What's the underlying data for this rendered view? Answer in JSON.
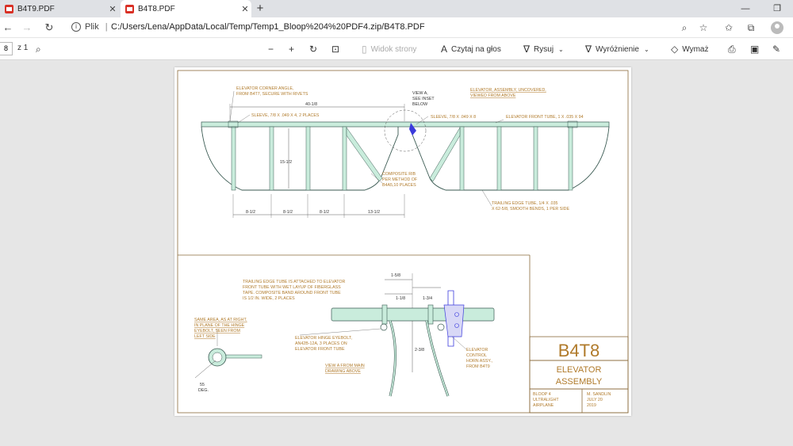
{
  "browser": {
    "tabs": [
      {
        "label": "B4T9.PDF",
        "active": false
      },
      {
        "label": "B4T8.PDF",
        "active": true
      }
    ],
    "site_label": "Plik",
    "url": "C:/Users/Lena/AppData/Local/Temp/Temp1_Bloop%204%20PDF4.zip/B4T8.PDF"
  },
  "pdf_toolbar": {
    "page_current": "8",
    "page_total": "z 1",
    "page_view": "Widok strony",
    "read_aloud": "Czytaj na głos",
    "draw": "Rysuj",
    "highlight": "Wyróżnienie",
    "erase": "Wymaż"
  },
  "drawing": {
    "title_block": {
      "number": "B4T8",
      "title_line1": "ELEVATOR",
      "title_line2": "ASSEMBLY",
      "project_line1": "BLOOP 4",
      "project_line2": "ULTRALIGHT",
      "project_line3": "AIRPLANE",
      "author": "M. SANDLIN",
      "date_line1": "JULY 20",
      "date_line2": "2019"
    },
    "notes": {
      "corner_angle_1": "ELEVATOR CORNER ANGLE,",
      "corner_angle_2": "FROM B4T7, SECURE WITH RIVETS",
      "dim_40": "40-1/8",
      "sleeve_left": "SLEEVE, 7/8 X .049 X 4, 2 PLACES",
      "view_a_1": "VIEW A,",
      "view_a_2": "SEE INSET",
      "view_a_3": "BELOW",
      "sleeve_center": "SLEEVE, 7/8 X .049 X 8",
      "assy_title_1": "ELEVATOR, ASSEMBLY, UNCOVERED,",
      "assy_title_2": "VIEWED FROM ABOVE",
      "front_tube": "ELEVATOR FRONT TUBE, 1 X .035 X 94",
      "dim_15": "15-1/2",
      "composite_rib_1": "COMPOSITE RIB",
      "composite_rib_2": "PER METHOD OF",
      "composite_rib_3": "B4A5,10 PLACES",
      "trailing_edge_1": "TRAILING EDGE TUBE, 1/4 X .035",
      "trailing_edge_2": "X 62-5/8, SMOOTH BENDS, 1 PER SIDE",
      "dim_8a": "8-1/2",
      "dim_8b": "8-1/2",
      "dim_8c": "8-1/2",
      "dim_13": "13-1/2",
      "te_attach_1": "TRAILING EDGE TUBE IS ATTACHED TO ELEVATOR",
      "te_attach_2": "FRONT TUBE WITH WET LAYUP OF FIBERGLASS",
      "te_attach_3": "TAPE. COMPOSITE BAND AROUND FRONT TUBE",
      "te_attach_4": "IS 1/2 IN. WIDE, 2 PLACES",
      "dim_1_5_8": "1-5/8",
      "dim_1_1_8": "1-1/8",
      "dim_1_3_4": "1-3/4",
      "dim_2_3_8": "2-3/8",
      "same_area_1": "SAME AREA, AS AT RIGHT,",
      "same_area_2": "IN PLANE OF THE HINGE",
      "same_area_3": "EYEBOLT, SEEN FROM",
      "same_area_4": "LEFT SIDE",
      "hinge_1": "ELEVATOR HINGE EYEBOLT,",
      "hinge_2": "AN42B-12A, 3 PLACES ON",
      "hinge_3": "ELEVATOR FRONT TUBE",
      "view_main_1": "VIEW A FROM MAIN",
      "view_main_2": "DRAWING ABOVE",
      "horn_1": "ELEVATOR",
      "horn_2": "CONTROL",
      "horn_3": "HORN ASSY.,",
      "horn_4": "FROM B4T9",
      "angle_1": "55",
      "angle_2": "DEG."
    }
  },
  "colors": {
    "tube_fill": "#c9ecdc",
    "tube_stroke": "#3a5a52",
    "label": "#b07a2a",
    "border": "#8a6a3a",
    "accent_blue": "#3b3bdc"
  }
}
